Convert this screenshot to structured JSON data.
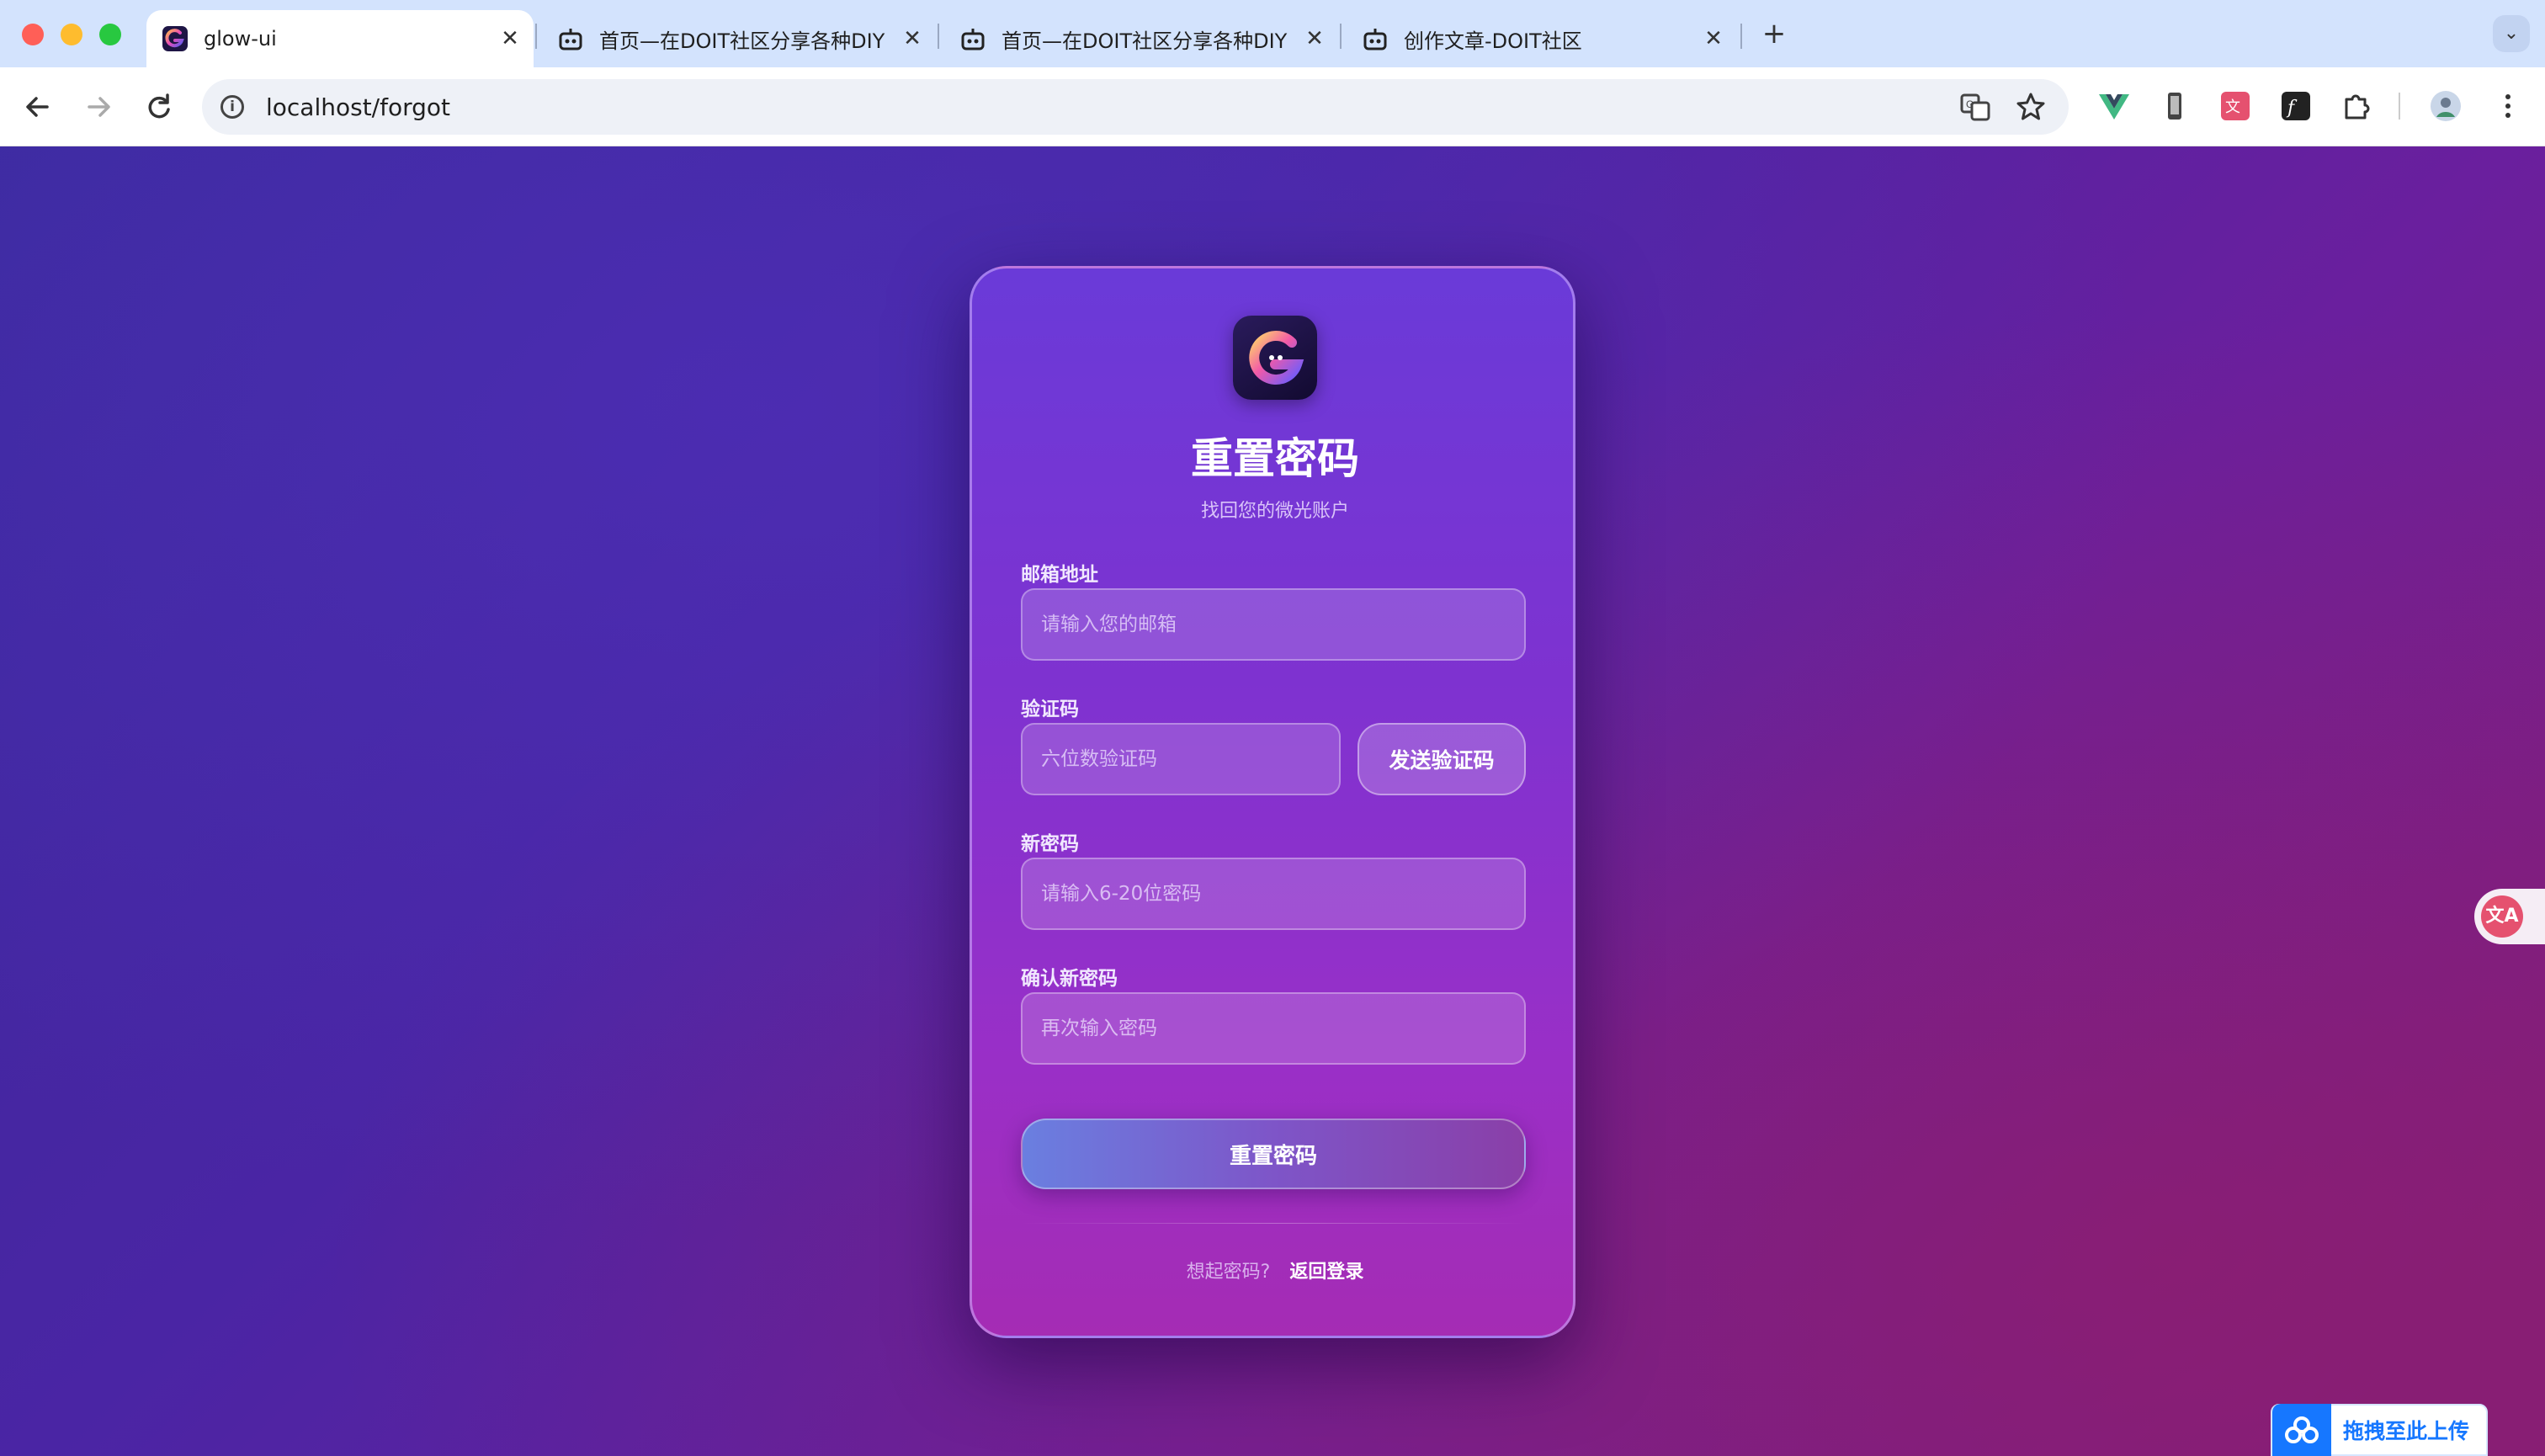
{
  "browser": {
    "tabs": [
      {
        "title": "glow-ui",
        "active": true,
        "favicon": "glow-logo-icon"
      },
      {
        "title": "首页—在DOIT社区分享各种DIY",
        "active": false,
        "favicon": "robot-icon"
      },
      {
        "title": "首页—在DOIT社区分享各种DIY",
        "active": false,
        "favicon": "robot-icon"
      },
      {
        "title": "创作文章-DOIT社区",
        "active": false,
        "favicon": "robot-icon"
      }
    ],
    "close_symbol": "✕",
    "new_tab_symbol": "+",
    "tab_menu_symbol": "⌄",
    "url": "localhost/forgot"
  },
  "form": {
    "title": "重置密码",
    "subtitle": "找回您的微光账户",
    "email": {
      "label": "邮箱地址",
      "placeholder": "请输入您的邮箱",
      "value": ""
    },
    "code": {
      "label": "验证码",
      "placeholder": "六位数验证码",
      "value": "",
      "send_button": "发送验证码"
    },
    "new_password": {
      "label": "新密码",
      "placeholder": "请输入6-20位密码",
      "value": ""
    },
    "confirm_password": {
      "label": "确认新密码",
      "placeholder": "再次输入密码",
      "value": ""
    },
    "submit_button": "重置密码",
    "footer": {
      "prompt": "想起密码?",
      "link": "返回登录"
    }
  },
  "overlays": {
    "translate_badge": "文A",
    "upload_widget": "拖拽至此上传"
  },
  "colors": {
    "page_bg_start": "#3a2a9c",
    "page_bg_end": "#7e1e7f",
    "card_top": "#6a3ad8",
    "card_bottom": "#a52cb4",
    "upload_blue": "#1677ff",
    "translate_pink": "#e5516f"
  }
}
